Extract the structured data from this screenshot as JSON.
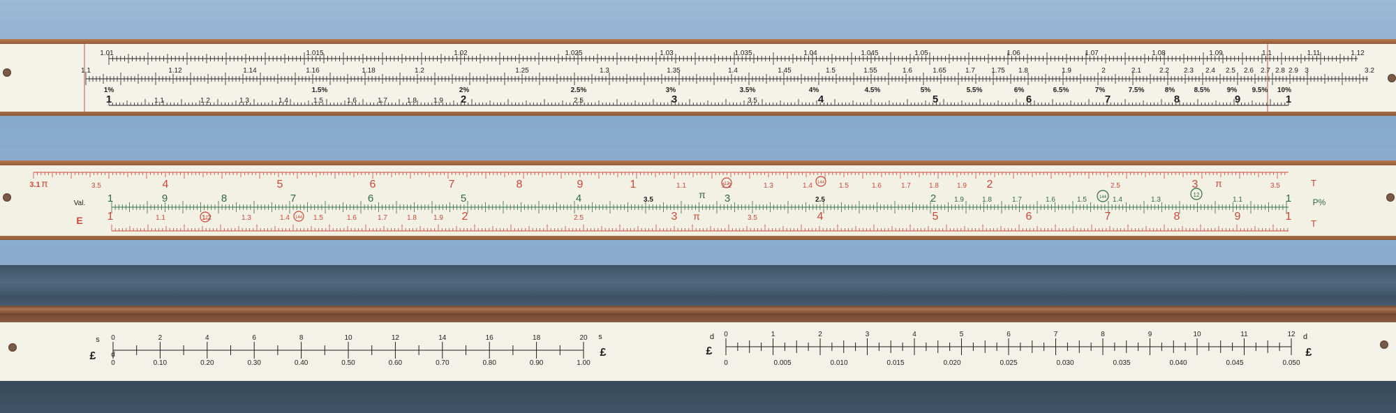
{
  "colors": {
    "black": "#1e1e1e",
    "red": "#c9463a",
    "green": "#2f6b3d",
    "board": "#f2f0e2",
    "wood": "#a5683f"
  },
  "strip1": {
    "row_a_labels": [
      "1.01",
      "1.015",
      "1.02",
      "1.025",
      "1.03",
      "1.035",
      "1.04",
      "1.045",
      "1.05",
      "1.06",
      "1.07",
      "1.08",
      "1.09",
      "1.1",
      "1.11",
      "1.12"
    ],
    "row_b_labels": [
      "1.1",
      "1.12",
      "1.14",
      "1.16",
      "1.18",
      "1.2",
      "1.25",
      "1.3",
      "1.35",
      "1.4",
      "1.45",
      "1.5",
      "1.55",
      "1.6",
      "1.65",
      "1.7",
      "1.75",
      "1.8",
      "1.9",
      "2",
      "2.1",
      "2.2",
      "2.3",
      "2.4",
      "2.5",
      "2.6",
      "2.7",
      "2.8",
      "2.9",
      "3",
      "3.2"
    ],
    "row_c_labels": [
      "1%",
      "1.5%",
      "2%",
      "2.5%",
      "3%",
      "3.5%",
      "4%",
      "4.5%",
      "5%",
      "5.5%",
      "6%",
      "6.5%",
      "7%",
      "7.5%",
      "8%",
      "8.5%",
      "9%",
      "9.5%",
      "10%"
    ],
    "row_d_labels": [
      "1",
      "1.1",
      "1.2",
      "1.3",
      "1.4",
      "1.5",
      "1.6",
      "1.7",
      "1.8",
      "1.9",
      "2",
      "2.5",
      "3",
      "3.5",
      "4",
      "5",
      "6",
      "7",
      "8",
      "9",
      "1"
    ]
  },
  "strip2": {
    "left_top": "3.1",
    "pi": "π",
    "row_a_labels": [
      "3.5",
      "4",
      "5",
      "6",
      "7",
      "8",
      "9",
      "1",
      "1.1",
      "1.2",
      "1.3",
      "1.4",
      "1.5",
      "1.6",
      "1.7",
      "1.8",
      "1.9",
      "2",
      "2.5",
      "3",
      "3.5"
    ],
    "circled_a": [
      "12",
      "144"
    ],
    "label_val": "Val.",
    "row_b_labels": [
      "1",
      "9",
      "8",
      "7",
      "6",
      "5",
      "4",
      "3.5",
      "3",
      "2.5",
      "2",
      "1.9",
      "1.8",
      "1.7",
      "1.6",
      "1.5",
      "1.4",
      "1.3",
      "1.1",
      "1"
    ],
    "circled_b": [
      "144",
      "12"
    ],
    "label_e": "E",
    "row_c_labels": [
      "1",
      "1.1",
      "1.2",
      "1.3",
      "1.4",
      "1.5",
      "1.6",
      "1.7",
      "1.8",
      "1.9",
      "2",
      "2.5",
      "3",
      "3.5",
      "4",
      "5",
      "6",
      "7",
      "8",
      "9",
      "1"
    ],
    "circled_c": [
      "12",
      "144"
    ],
    "right_t1": "T",
    "right_p": "P%",
    "right_t2": "T"
  },
  "strip3": {
    "left_s": "s",
    "left_pound": "£",
    "left_d": "d",
    "s_top": [
      "0",
      "2",
      "4",
      "6",
      "8",
      "10",
      "12",
      "14",
      "16",
      "18",
      "20"
    ],
    "s_top_right": "s",
    "s_bottom": [
      "0",
      "0.10",
      "0.20",
      "0.30",
      "0.40",
      "0.50",
      "0.60",
      "0.70",
      "0.80",
      "0.90",
      "1.00"
    ],
    "s_bottom_right": "£",
    "d_top_left": "d",
    "d_top": [
      "0",
      "1",
      "2",
      "3",
      "4",
      "5",
      "6",
      "7",
      "8",
      "9",
      "10",
      "11",
      "12"
    ],
    "d_top_right": "d",
    "d_left_pound": "£",
    "d_bottom": [
      "0",
      "0.005",
      "0.010",
      "0.015",
      "0.020",
      "0.025",
      "0.030",
      "0.035",
      "0.040",
      "0.045",
      "0.050"
    ],
    "d_bottom_right": "£"
  }
}
